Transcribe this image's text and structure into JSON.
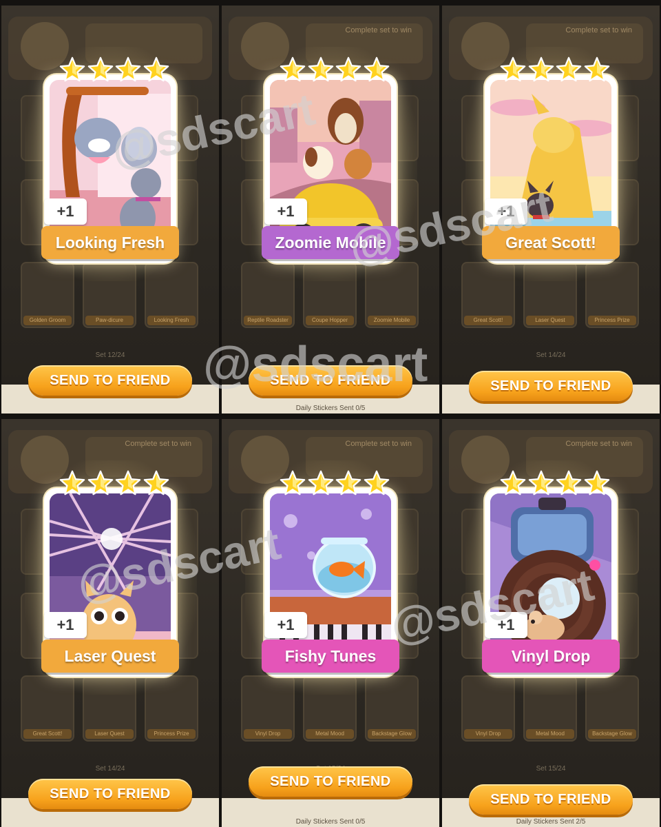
{
  "watermark": "@sdscart",
  "panels": [
    {
      "card": {
        "name": "Looking Fresh",
        "count_badge": "+1",
        "stars": 4,
        "banner_color": "#f2a93c",
        "art_theme": "cats-mirror"
      },
      "send_button": "SEND TO FRIEND",
      "set_progress": "Set 12/24",
      "daily_sent": "",
      "bg_slots": [
        "Golden Groom",
        "Paw-dicure",
        "Looking Fresh"
      ],
      "header_text": ""
    },
    {
      "card": {
        "name": "Zoomie Mobile",
        "count_badge": "+1",
        "stars": 4,
        "banner_color": "#b468d0",
        "art_theme": "dogs-car"
      },
      "send_button": "SEND TO FRIEND",
      "set_progress": "",
      "daily_sent": "Daily Stickers Sent 0/5",
      "bg_slots": [
        "Reptile Roadster",
        "Coupe Hopper",
        "Zoomie Mobile"
      ],
      "header_text": "Complete set to win"
    },
    {
      "card": {
        "name": "Great Scott!",
        "count_badge": "+1",
        "stars": 4,
        "banner_color": "#f2a93c",
        "art_theme": "dog-statue"
      },
      "send_button": "SEND TO FRIEND",
      "set_progress": "Set 14/24",
      "daily_sent": "",
      "bg_slots": [
        "Great Scott!",
        "Laser Quest",
        "Princess Prize"
      ],
      "header_text": "Complete set to win"
    },
    {
      "card": {
        "name": "Laser Quest",
        "count_badge": "+1",
        "stars": 4,
        "banner_color": "#f2a93c",
        "art_theme": "cat-laser"
      },
      "send_button": "SEND TO FRIEND",
      "set_progress": "Set 14/24",
      "daily_sent": "",
      "bg_slots": [
        "Great Scott!",
        "Laser Quest",
        "Princess Prize"
      ],
      "header_text": "Complete set to win"
    },
    {
      "card": {
        "name": "Fishy Tunes",
        "count_badge": "+1",
        "stars": 4,
        "banner_color": "#e455b8",
        "art_theme": "fishbowl-piano"
      },
      "send_button": "SEND TO FRIEND",
      "set_progress": "Set 15/24",
      "daily_sent": "Daily Stickers Sent 0/5",
      "bg_slots": [
        "Vinyl Drop",
        "Metal Mood",
        "Backstage Glow"
      ],
      "header_text": "Complete set to win"
    },
    {
      "card": {
        "name": "Vinyl Drop",
        "count_badge": "+1",
        "stars": 4,
        "banner_color": "#e455b8",
        "art_theme": "hamster-vinyl"
      },
      "send_button": "SEND TO FRIEND",
      "set_progress": "Set 15/24",
      "daily_sent": "Daily Stickers Sent 2/5",
      "bg_slots": [
        "Vinyl Drop",
        "Metal Mood",
        "Backstage Glow"
      ],
      "header_text": "Complete set to win"
    }
  ],
  "colors": {
    "button_orange": "#f7a21c",
    "star_gold": "#ffd21f",
    "card_border": "#ffffff"
  }
}
